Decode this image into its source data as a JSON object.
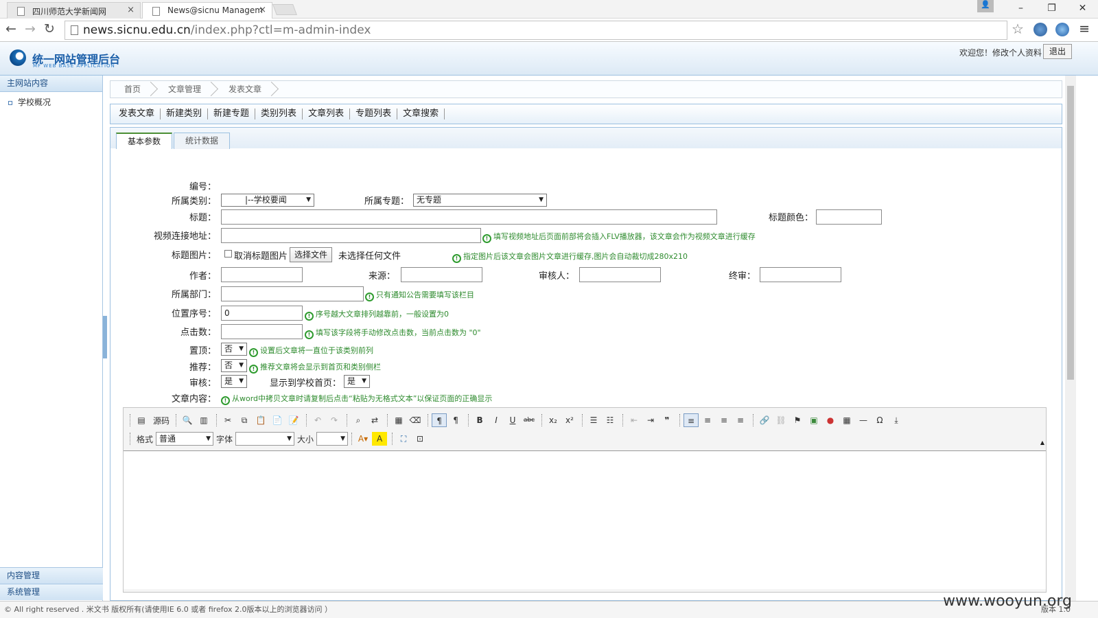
{
  "browser": {
    "tabs": [
      {
        "title": "四川师范大学新闻网"
      },
      {
        "title": "News@sicnu Managem"
      }
    ],
    "url_host": "news.sicnu.edu.cn",
    "url_path": "/index.php?ctl=m-admin-index"
  },
  "header": {
    "title": "统一网站管理后台",
    "subtitle": "MF WEB BASE APPLICATION",
    "welcome": "欢迎您！修改个人资料",
    "logout": "退出"
  },
  "sidebar": {
    "section": "主网站内容",
    "items": [
      {
        "label": "学校概况"
      }
    ],
    "bottom": [
      {
        "label": "内容管理"
      },
      {
        "label": "系统管理"
      }
    ]
  },
  "breadcrumb": [
    "首页",
    "文章管理",
    "发表文章"
  ],
  "subnav": [
    "发表文章",
    "新建类别",
    "新建专题",
    "类别列表",
    "文章列表",
    "专题列表",
    "文章搜索"
  ],
  "panel_tabs": [
    "基本参数",
    "统计数据"
  ],
  "form": {
    "id_label": "编号：",
    "category_label": "所属类别：",
    "category_value": "|--学校要闻",
    "topic_label": "所属专题：",
    "topic_value": "无专题",
    "title_label": "标题：",
    "title_color_label": "标题颜色：",
    "video_label": "视频连接地址：",
    "video_hint": "填写视频地址后页面前部将会插入FLV播放器，该文章会作为视频文章进行缓存",
    "image_label": "标题图片：",
    "cancel_image": "取消标题图片",
    "choose_file": "选择文件",
    "no_file": "未选择任何文件",
    "image_hint": "指定图片后该文章会图片文章进行缓存,图片会自动裁切成280x210",
    "author_label": "作者：",
    "source_label": "来源：",
    "reviewer_label": "审核人：",
    "final_label": "终审：",
    "dept_label": "所属部门：",
    "dept_hint": "只有通知公告需要填写该栏目",
    "order_label": "位置序号：",
    "order_value": "0",
    "order_hint": "序号越大文章排列越靠前，一般设置为0",
    "clicks_label": "点击数：",
    "clicks_hint": "填写该字段将手动修改点击数，当前点击数为 \"0\"",
    "top_label": "置顶：",
    "top_value": "否",
    "top_hint": "设置后文章将一直位于该类别前列",
    "rec_label": "推荐：",
    "rec_value": "否",
    "rec_hint": "推荐文章将会显示到首页和类别侧栏",
    "audit_label": "审核：",
    "audit_value": "是",
    "show_label": "显示到学校首页：",
    "show_value": "是",
    "content_label": "文章内容：",
    "content_hint": "从word中拷贝文章时请复制后点击“粘贴为无格式文本”以保证页面的正确显示"
  },
  "editor": {
    "source_label": "源码",
    "format_label": "格式",
    "format_value": "普通",
    "font_label": "字体",
    "size_label": "大小"
  },
  "footer": {
    "text": "© All right reserved . 米文书 版权所有(请使用IE 6.0 或者 firefox 2.0版本以上的浏览器访问 ）",
    "version": "版本 1.0",
    "watermark": "www.wooyun.org"
  }
}
